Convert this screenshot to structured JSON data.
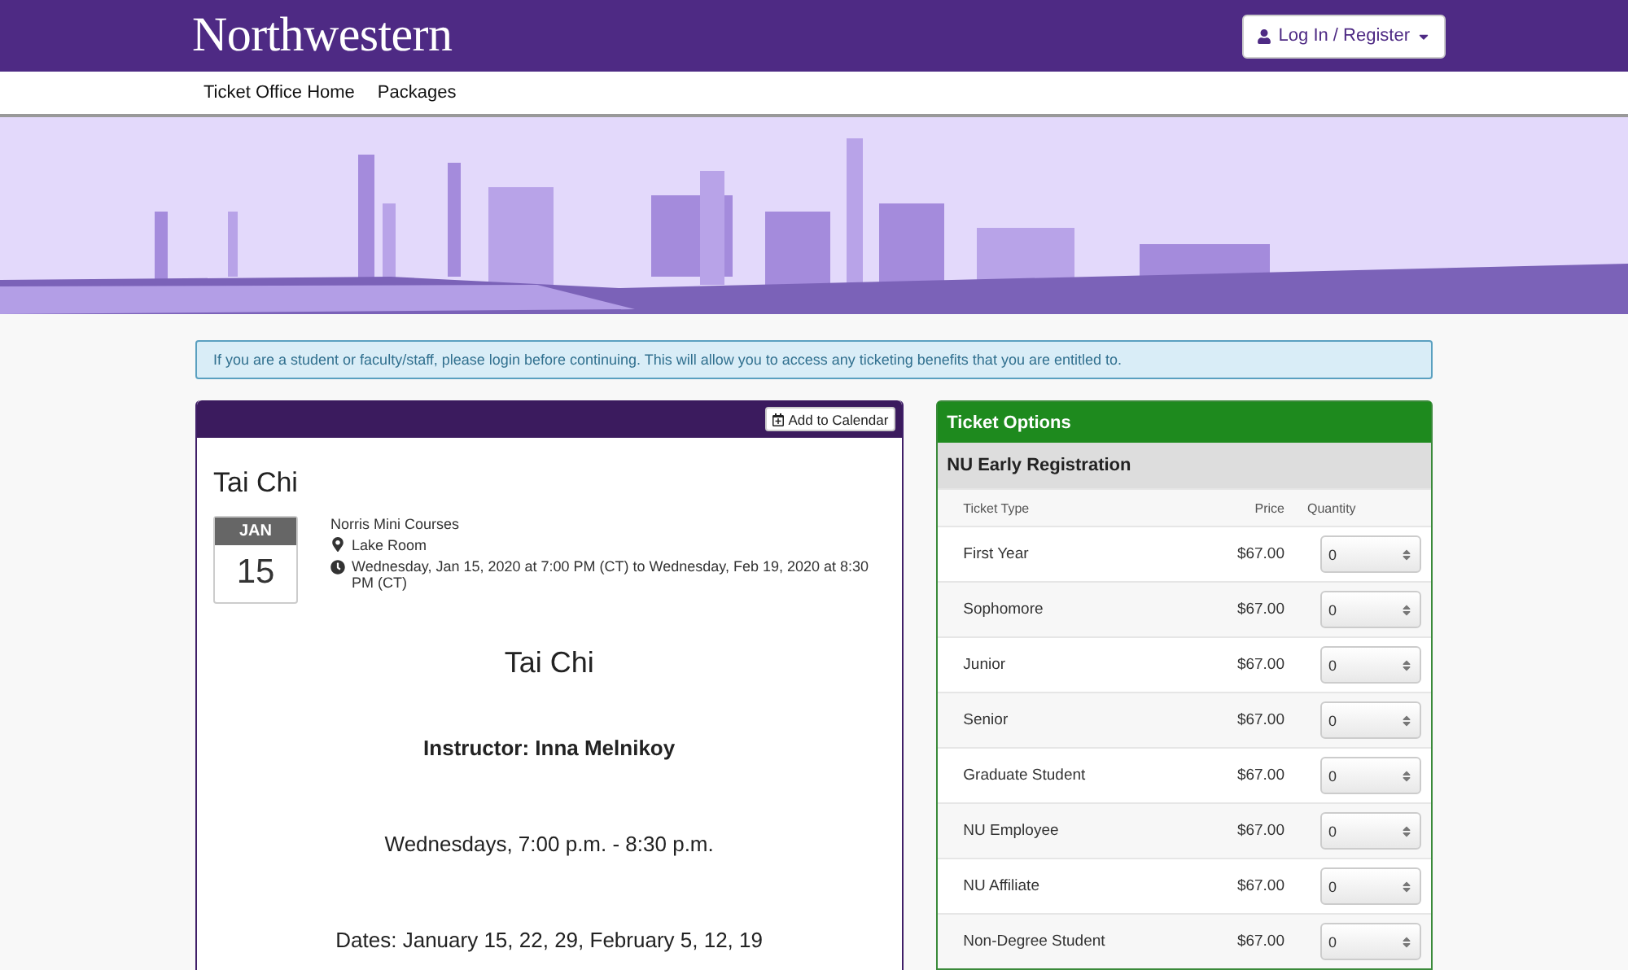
{
  "header": {
    "logo": "Northwestern",
    "login_button": "Log In / Register"
  },
  "nav": [
    "Ticket Office Home",
    "Packages"
  ],
  "banner": {
    "kind": "picture"
  },
  "alert": "If you are a student or faculty/staff, please login before continuing. This will allow you to access any ticketing benefits that you are entitled to.",
  "event": {
    "add_to_calendar": "Add to Calendar",
    "title": "Tai Chi",
    "date_month": "JAN",
    "date_day": "15",
    "organizer": "Norris Mini Courses",
    "location": "Lake Room",
    "time": "Wednesday, Jan 15, 2020 at 7:00 PM (CT) to Wednesday, Feb 19, 2020 at 8:30 PM (CT)",
    "description": [
      {
        "kind": "heading",
        "text": "Tai Chi"
      },
      {
        "kind": "bold",
        "text": "Instructor: Inna Melnikoy"
      },
      {
        "kind": "plain",
        "text": "Wednesdays, 7:00 p.m. - 8:30 p.m."
      },
      {
        "kind": "plain",
        "text": "Dates: January 15, 22, 29, February 5, 12, 19"
      }
    ]
  },
  "tickets": {
    "title": "Ticket Options",
    "section": "NU Early Registration",
    "columns": [
      "Ticket Type",
      "Price",
      "Quantity"
    ],
    "rows": [
      {
        "type": "First Year",
        "price": "$67.00",
        "quantity": "0"
      },
      {
        "type": "Sophomore",
        "price": "$67.00",
        "quantity": "0"
      },
      {
        "type": "Junior",
        "price": "$67.00",
        "quantity": "0"
      },
      {
        "type": "Senior",
        "price": "$67.00",
        "quantity": "0"
      },
      {
        "type": "Graduate Student",
        "price": "$67.00",
        "quantity": "0"
      },
      {
        "type": "NU Employee",
        "price": "$67.00",
        "quantity": "0"
      },
      {
        "type": "NU Affiliate",
        "price": "$67.00",
        "quantity": "0"
      },
      {
        "type": "Non-Degree Student",
        "price": "$67.00",
        "quantity": "0"
      }
    ]
  }
}
